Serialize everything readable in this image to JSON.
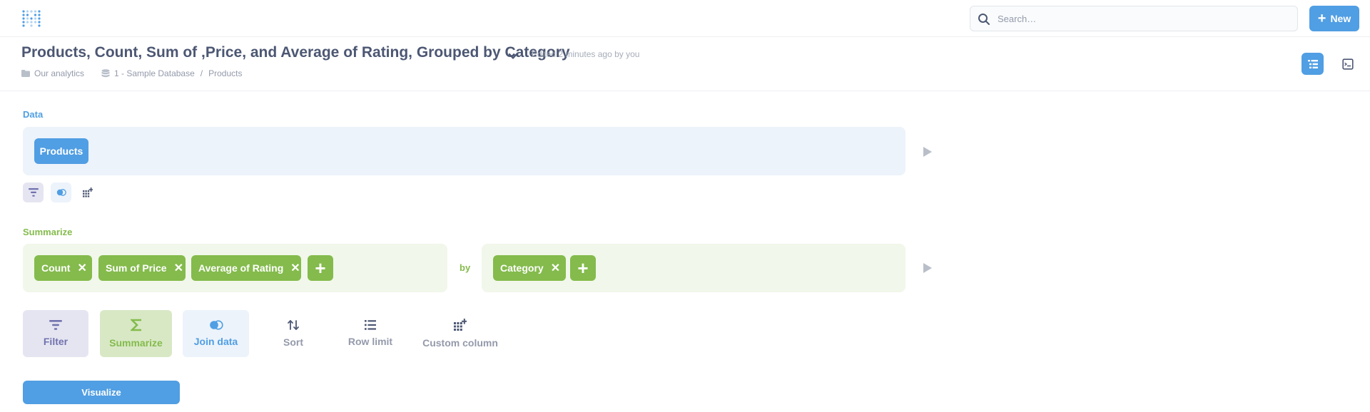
{
  "topbar": {
    "search_placeholder": "Search…",
    "new_label": "New"
  },
  "header": {
    "title": "Products, Count, Sum of ,Price, and Average of Rating, Grouped by Category",
    "edited": "Edited 2 minutes ago by you",
    "collection": "Our analytics",
    "database": "1 - Sample Database",
    "separator": "/",
    "table": "Products"
  },
  "data_step": {
    "label": "Data",
    "source": "Products"
  },
  "summarize_step": {
    "label": "Summarize",
    "metrics": [
      "Count",
      "Sum of Price",
      "Average of Rating"
    ],
    "by_label": "by",
    "breakouts": [
      "Category"
    ]
  },
  "actions": {
    "filter": "Filter",
    "summarize": "Summarize",
    "join": "Join data",
    "sort": "Sort",
    "row_limit": "Row limit",
    "custom_column": "Custom column"
  },
  "visualize_label": "Visualize",
  "colors": {
    "brand": "#509ee3",
    "summarize": "#84bb4c",
    "filter": "#7172ad"
  }
}
